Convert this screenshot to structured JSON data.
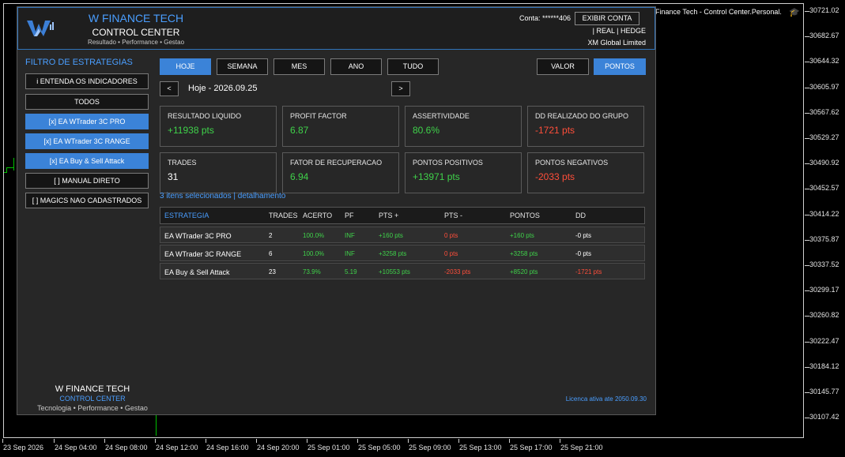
{
  "chart": {
    "title": "Finance Tech - Control Center.Personal.",
    "price_labels": [
      "30721.02",
      "30682.67",
      "30644.32",
      "30605.97",
      "30567.62",
      "30529.27",
      "30490.92",
      "30452.57",
      "30414.22",
      "30375.87",
      "30337.52",
      "30299.17",
      "30260.82",
      "30222.47",
      "30184.12",
      "30145.77",
      "30107.42"
    ],
    "time_labels": [
      "23 Sep 2026",
      "24 Sep 04:00",
      "24 Sep 08:00",
      "24 Sep 12:00",
      "24 Sep 16:00",
      "24 Sep 20:00",
      "25 Sep 01:00",
      "25 Sep 05:00",
      "25 Sep 09:00",
      "25 Sep 13:00",
      "25 Sep 17:00",
      "25 Sep 21:00"
    ]
  },
  "header": {
    "brand_title": "W FINANCE TECH",
    "brand_subtitle": "CONTROL CENTER",
    "brand_tagline": "Resultado • Performance • Gestao",
    "account": "Conta: ******406",
    "show_button": "EXIBIR CONTA",
    "mode_line": "| REAL | HEDGE",
    "broker": "XM Global Limited"
  },
  "sidebar": {
    "title": "FILTRO DE ESTRATEGIAS",
    "buttons": [
      {
        "label": "i  ENTENDA OS INDICADORES",
        "selected": false
      },
      {
        "label": "TODOS",
        "selected": false
      },
      {
        "label": "[x] EA WTrader 3C PRO",
        "selected": true
      },
      {
        "label": "[x] EA WTrader 3C RANGE",
        "selected": true
      },
      {
        "label": "[x] EA Buy & Sell Attack",
        "selected": true
      },
      {
        "label": "[ ] MANUAL DIRETO",
        "selected": false
      },
      {
        "label": "[ ] MAGICS NAO CADASTRADOS",
        "selected": false
      }
    ]
  },
  "tabs": {
    "period": [
      "HOJE",
      "SEMANA",
      "MES",
      "ANO",
      "TUDO"
    ],
    "unit": [
      "VALOR",
      "PONTOS"
    ],
    "active_period": "HOJE",
    "active_unit": "PONTOS"
  },
  "date_nav": {
    "prev": "<",
    "next": ">",
    "label": "Hoje - 2026.09.25"
  },
  "cards": [
    {
      "label": "RESULTADO LIQUIDO",
      "value": "+11938 pts",
      "tone": "green"
    },
    {
      "label": "PROFIT FACTOR",
      "value": "6.87",
      "tone": "green"
    },
    {
      "label": "ASSERTIVIDADE",
      "value": "80.6%",
      "tone": "green"
    },
    {
      "label": "DD REALIZADO DO GRUPO",
      "value": "-1721 pts",
      "tone": "red"
    },
    {
      "label": "TRADES",
      "value": "31",
      "tone": "white"
    },
    {
      "label": "FATOR DE RECUPERACAO",
      "value": "6.94",
      "tone": "green"
    },
    {
      "label": "PONTOS POSITIVOS",
      "value": "+13971 pts",
      "tone": "green"
    },
    {
      "label": "PONTOS NEGATIVOS",
      "value": "-2033 pts",
      "tone": "red"
    }
  ],
  "selection_info": "3 itens selecionados  |  detalhamento",
  "table": {
    "headers": [
      "ESTRATEGIA",
      "TRADES",
      "ACERTO",
      "PF",
      "PTS +",
      "PTS -",
      "PONTOS",
      "DD"
    ],
    "rows": [
      [
        "EA WTrader 3C PRO",
        "2",
        "100.0%",
        "INF",
        "+160 pts",
        "0 pts",
        "+160 pts",
        "-0 pts"
      ],
      [
        "EA WTrader 3C RANGE",
        "6",
        "100.0%",
        "INF",
        "+3258 pts",
        "0 pts",
        "+3258 pts",
        "-0 pts"
      ],
      [
        "EA Buy & Sell Attack",
        "23",
        "73.9%",
        "5.19",
        "+10553 pts",
        "-2033 pts",
        "+8520 pts",
        "-1721 pts"
      ]
    ],
    "row_tones": [
      [
        "white",
        "white",
        "green",
        "green",
        "green",
        "red",
        "green",
        "white"
      ],
      [
        "white",
        "white",
        "green",
        "green",
        "green",
        "red",
        "green",
        "white"
      ],
      [
        "white",
        "white",
        "green",
        "green",
        "green",
        "red",
        "green",
        "red"
      ]
    ]
  },
  "footer": {
    "title": "W FINANCE TECH",
    "subtitle": "CONTROL CENTER",
    "tagline": "Tecnologia • Performance • Gestao",
    "license": "Licenca ativa ate 2050.09.30"
  },
  "colors": {
    "accent": "#3b83d8",
    "brand_blue": "#4a9eff",
    "positive": "#3fd24a",
    "negative": "#ff4e3a",
    "panel_bg": "#272727"
  }
}
